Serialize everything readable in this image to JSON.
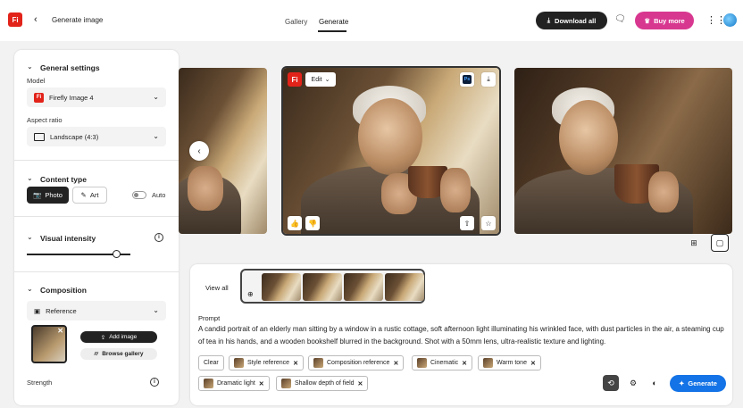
{
  "header": {
    "logo": "Fi",
    "back_icon": "chevron-left-icon",
    "title": "Generate image",
    "tabs": [
      {
        "label": "Gallery"
      },
      {
        "label": "Generate"
      }
    ],
    "download_label": "Download all",
    "buy_label": "Buy more"
  },
  "settings": {
    "general_title": "General settings",
    "model_label": "Model",
    "model_badge": "Fi",
    "model_value": "Firefly Image 4",
    "aspect_label": "Aspect ratio",
    "aspect_value": "Landscape (4:3)",
    "content_title": "Content type",
    "content_photo": "Photo",
    "content_art": "Art",
    "content_auto": "Auto",
    "intensity_title": "Visual intensity",
    "intensity_level": 0.86,
    "composition_title": "Composition",
    "reference_label": "Reference",
    "add_image": "Add image",
    "browse_gallery": "Browse gallery",
    "strength_label": "Strength"
  },
  "canvas": {
    "card_logo": "Fi",
    "edit_label": "Edit",
    "ps_badge": "Ps"
  },
  "bottom": {
    "view_all": "View all",
    "prompt_label": "Prompt",
    "prompt_text": "A candid portrait of an elderly man sitting by a window in a rustic cottage, soft afternoon light illuminating his wrinkled face, with dust particles in the air, a steaming cup of tea in his hands, and a wooden bookshelf blurred in the background. Shot with a 50mm lens, ultra-realistic texture and lighting.",
    "clear_label": "Clear",
    "chips": [
      {
        "label": "Style reference"
      },
      {
        "label": "Composition reference"
      },
      {
        "label": "Cinematic"
      },
      {
        "label": "Warm tone"
      },
      {
        "label": "Dramatic light"
      },
      {
        "label": "Shallow depth of field"
      }
    ],
    "generate_label": "Generate"
  },
  "colors": {
    "accent_blue": "#1473e6",
    "buy_pink": "#d83790",
    "brand_red": "#e2231a"
  }
}
